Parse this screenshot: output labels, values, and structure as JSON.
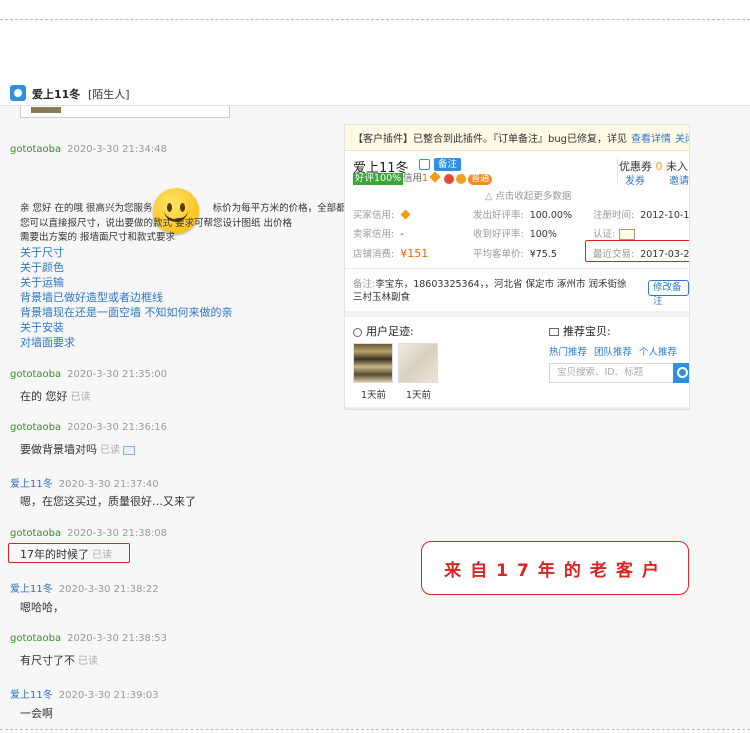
{
  "header": {
    "contact_name": "爱上11冬",
    "contact_tag": "[陌生人]"
  },
  "messages": [
    {
      "sender": "gototaoba",
      "role": "seller",
      "time": "2020-3-30 21:34:48",
      "lines": [
        "亲 您好 在的哦 很高兴为您服务",
        "标价为每平方米的价格，全部都是",
        "您可以直接报尺寸，说出要做的款式 要求可帮您设计图纸 出价格",
        "需要出方案的 报墙面尺寸和款式要求"
      ],
      "links": [
        "关于尺寸",
        "关于颜色",
        "关于运输",
        "背景墙已做好造型或者边框线",
        "背景墙现在还是一面空墙 不知如何来做的亲",
        "关于安装",
        "对墙面要求"
      ]
    },
    {
      "sender": "gototaoba",
      "role": "seller",
      "time": "2020-3-30 21:35:00",
      "text": "在的 您好",
      "read": "已读"
    },
    {
      "sender": "gototaoba",
      "role": "seller",
      "time": "2020-3-30 21:36:16",
      "text": "要做背景墙对吗",
      "read": "已读"
    },
    {
      "sender": "爱上11冬",
      "role": "buyer",
      "time": "2020-3-30 21:37:40",
      "text": "嗯，在您这买过，质量很好…又来了"
    },
    {
      "sender": "gototaoba",
      "role": "seller",
      "time": "2020-3-30 21:38:08",
      "text": "17年的时候了",
      "read": "已读"
    },
    {
      "sender": "爱上11冬",
      "role": "buyer",
      "time": "2020-3-30 21:38:22",
      "text": "嗯哈哈，"
    },
    {
      "sender": "gototaoba",
      "role": "seller",
      "time": "2020-3-30 21:38:53",
      "text": "有尺寸了不",
      "read": "已读"
    },
    {
      "sender": "爱上11冬",
      "role": "buyer",
      "time": "2020-3-30 21:39:03",
      "text": "一会啊"
    }
  ],
  "panel": {
    "notice": "【客户插件】已整合到此插件。『订单备注』bug已修复，详见",
    "notice_link": "查看详情",
    "notice_close": "关闭",
    "name": "爱上11冬",
    "note_btn": "备注",
    "rate_badge": "好评100%",
    "credit_label": "信用",
    "credit_num": "1",
    "level": "普通",
    "coupon_label": "优惠券",
    "coupon_num": "0",
    "unused": "未入",
    "send": "发券",
    "auth_link": "邀请",
    "collapse": "△ 点击收起更多数据",
    "info": {
      "buyer_credit_label": "买家信用:",
      "seller_credit_label": "卖家信用:",
      "seller_credit_value": "-",
      "shop_spend_label": "店铺消费:",
      "shop_spend_value": "¥151",
      "good_rate_out_label": "发出好评率:",
      "good_rate_out_value": "100.00%",
      "good_rate_in_label": "收到好评率:",
      "good_rate_in_value": "100%",
      "avg_price_label": "平均客单价:",
      "avg_price_value": "¥75.5",
      "reg_label": "注册时间:",
      "reg_value": "2012-10-1",
      "auth_label": "认证:",
      "last_trade_label": "最近交易:",
      "last_trade_value": "2017-03-2"
    },
    "remark_label": "备注:",
    "remark_text": "李宝东，18603325364，，河北省 保定市 涿州市 润禾街徐三村玉林副食",
    "edit_btn": "修改备注",
    "footprints_title": "用户足迹:",
    "footprints": [
      {
        "label": "1天前"
      },
      {
        "label": "1天前"
      }
    ],
    "rec_title": "推荐宝贝:",
    "rec_tabs": [
      "热门推荐",
      "团队推荐",
      "个人推荐"
    ],
    "search_placeholder": "宝贝搜索、ID、标题"
  },
  "callout": "来自17年的老客户",
  "colors": {
    "accent": "#2f8fe0",
    "highlight_red": "#dd2222",
    "seller_nick": "#3a8a2a",
    "buyer_nick": "#2f6fc0"
  }
}
